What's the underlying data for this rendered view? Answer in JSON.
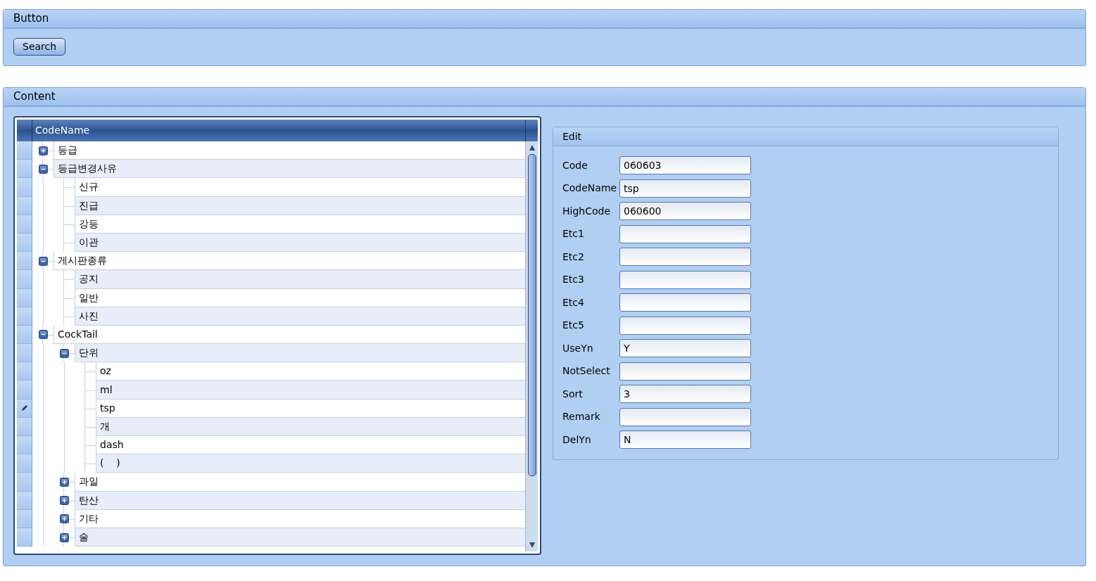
{
  "button_panel": {
    "title": "Button",
    "search_button": "Search"
  },
  "content_panel": {
    "title": "Content"
  },
  "tree": {
    "column": "CodeName",
    "nodes": [
      {
        "label": "등급",
        "expanded": false,
        "current": false
      },
      {
        "label": "등급변경사유",
        "expanded": true,
        "current": false,
        "children": [
          {
            "label": "신규",
            "current": false
          },
          {
            "label": "진급",
            "current": false
          },
          {
            "label": "강등",
            "current": false
          },
          {
            "label": "이관",
            "current": false
          }
        ]
      },
      {
        "label": "게시판종류",
        "expanded": true,
        "current": false,
        "children": [
          {
            "label": "공지",
            "current": false
          },
          {
            "label": "일반",
            "current": false
          },
          {
            "label": "사진",
            "current": false
          }
        ]
      },
      {
        "label": "CockTail",
        "expanded": true,
        "current": false,
        "children": [
          {
            "label": "단위",
            "expanded": true,
            "current": false,
            "children": [
              {
                "label": "oz",
                "current": false
              },
              {
                "label": "ml",
                "current": false
              },
              {
                "label": "tsp",
                "current": true
              },
              {
                "label": "개",
                "current": false
              },
              {
                "label": "dash",
                "current": false
              },
              {
                "label": "(    )",
                "current": false
              }
            ]
          },
          {
            "label": "과일",
            "expanded": false,
            "current": false
          },
          {
            "label": "탄산",
            "expanded": false,
            "current": false
          },
          {
            "label": "기타",
            "expanded": false,
            "current": false
          },
          {
            "label": "술",
            "expanded": false,
            "current": false
          }
        ]
      }
    ]
  },
  "edit": {
    "title": "Edit",
    "fields": [
      {
        "label": "Code",
        "value": "060603"
      },
      {
        "label": "CodeName",
        "value": "tsp"
      },
      {
        "label": "HighCode",
        "value": "060600"
      },
      {
        "label": "Etc1"
      },
      {
        "label": "Etc2"
      },
      {
        "label": "Etc3"
      },
      {
        "label": "Etc4"
      },
      {
        "label": "Etc5"
      },
      {
        "label": "UseYn",
        "value": "Y"
      },
      {
        "label": "NotSelect"
      },
      {
        "label": "Sort",
        "value": "3"
      },
      {
        "label": "Remark"
      },
      {
        "label": "DelYn",
        "value": "N"
      }
    ]
  }
}
